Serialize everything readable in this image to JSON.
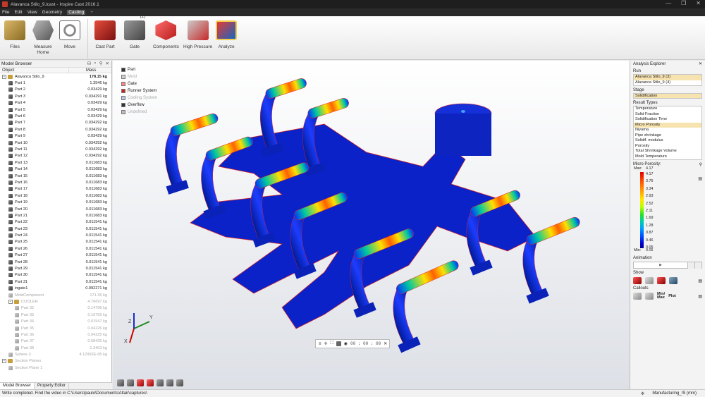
{
  "window": {
    "title": "Alavanca Stilo_9.icast - Inspire Cast 2016.1",
    "controls": [
      "—",
      "❐",
      "✕"
    ]
  },
  "menu": [
    {
      "label": "File",
      "active": false
    },
    {
      "label": "Edit",
      "active": false
    },
    {
      "label": "View",
      "active": false
    },
    {
      "label": "Geometry",
      "active": false
    },
    {
      "label": "Casting",
      "active": true
    }
  ],
  "ribbon": {
    "files": "Files",
    "measure": "Measure",
    "home": "Home",
    "move": "Move",
    "cast_part": "Cast Part",
    "gate": "Gate",
    "gate_badge": "(1)",
    "components": "Components",
    "high_pressure": "High Pressure",
    "analyze": "Analyze"
  },
  "model_browser": {
    "title": "Model Browser",
    "col_object": "Object",
    "col_mass": "Mass",
    "rows": [
      {
        "name": "Alavanca Stilo_9",
        "mass": "178.15 kg",
        "level": 0,
        "type": "asm",
        "expand": "−",
        "bold": true,
        "dim": false
      },
      {
        "name": "Part 1",
        "mass": "1.3546 kg",
        "level": 1,
        "type": "part",
        "dim": false
      },
      {
        "name": "Part 2",
        "mass": "0.03429 kg",
        "level": 1,
        "type": "part",
        "dim": false
      },
      {
        "name": "Part 3",
        "mass": "0.034291 kg",
        "level": 1,
        "type": "part",
        "dim": false
      },
      {
        "name": "Part 4",
        "mass": "0.03429 kg",
        "level": 1,
        "type": "part",
        "dim": false
      },
      {
        "name": "Part 5",
        "mass": "0.03429 kg",
        "level": 1,
        "type": "part",
        "dim": false
      },
      {
        "name": "Part 6",
        "mass": "0.03429 kg",
        "level": 1,
        "type": "part",
        "dim": false
      },
      {
        "name": "Part 7",
        "mass": "0.034292 kg",
        "level": 1,
        "type": "part",
        "dim": false
      },
      {
        "name": "Part 8",
        "mass": "0.034292 kg",
        "level": 1,
        "type": "part",
        "dim": false
      },
      {
        "name": "Part 9",
        "mass": "0.03429 kg",
        "level": 1,
        "type": "part",
        "dim": false
      },
      {
        "name": "Part 10",
        "mass": "0.034292 kg",
        "level": 1,
        "type": "part",
        "dim": false
      },
      {
        "name": "Part 11",
        "mass": "0.034292 kg",
        "level": 1,
        "type": "part",
        "dim": false
      },
      {
        "name": "Part 12",
        "mass": "0.034292 kg",
        "level": 1,
        "type": "part",
        "dim": false
      },
      {
        "name": "Part 13",
        "mass": "0.011683 kg",
        "level": 1,
        "type": "part",
        "dim": false
      },
      {
        "name": "Part 14",
        "mass": "0.011683 kg",
        "level": 1,
        "type": "part",
        "dim": false
      },
      {
        "name": "Part 15",
        "mass": "0.011683 kg",
        "level": 1,
        "type": "part",
        "dim": false
      },
      {
        "name": "Part 16",
        "mass": "0.011683 kg",
        "level": 1,
        "type": "part",
        "dim": false
      },
      {
        "name": "Part 17",
        "mass": "0.011683 kg",
        "level": 1,
        "type": "part",
        "dim": false
      },
      {
        "name": "Part 18",
        "mass": "0.011683 kg",
        "level": 1,
        "type": "part",
        "dim": false
      },
      {
        "name": "Part 19",
        "mass": "0.011683 kg",
        "level": 1,
        "type": "part",
        "dim": false
      },
      {
        "name": "Part 20",
        "mass": "0.011683 kg",
        "level": 1,
        "type": "part",
        "dim": false
      },
      {
        "name": "Part 21",
        "mass": "0.011683 kg",
        "level": 1,
        "type": "part",
        "dim": false
      },
      {
        "name": "Part 22",
        "mass": "0.011541 kg",
        "level": 1,
        "type": "part",
        "dim": false
      },
      {
        "name": "Part 23",
        "mass": "0.011541 kg",
        "level": 1,
        "type": "part",
        "dim": false
      },
      {
        "name": "Part 24",
        "mass": "0.011541 kg",
        "level": 1,
        "type": "part",
        "dim": false
      },
      {
        "name": "Part 25",
        "mass": "0.011541 kg",
        "level": 1,
        "type": "part",
        "dim": false
      },
      {
        "name": "Part 26",
        "mass": "0.011541 kg",
        "level": 1,
        "type": "part",
        "dim": false
      },
      {
        "name": "Part 27",
        "mass": "0.011541 kg",
        "level": 1,
        "type": "part",
        "dim": false
      },
      {
        "name": "Part 28",
        "mass": "0.011541 kg",
        "level": 1,
        "type": "part",
        "dim": false
      },
      {
        "name": "Part 29",
        "mass": "0.011541 kg",
        "level": 1,
        "type": "part",
        "dim": false
      },
      {
        "name": "Part 30",
        "mass": "0.011541 kg",
        "level": 1,
        "type": "part",
        "dim": false
      },
      {
        "name": "Part 31",
        "mass": "0.011541 kg",
        "level": 1,
        "type": "part",
        "dim": false
      },
      {
        "name": "ingate1",
        "mass": "0.092271 kg",
        "level": 1,
        "type": "part",
        "dim": false
      },
      {
        "name": "MoldComponent",
        "mass": "171.36 kg",
        "level": 1,
        "type": "partlight",
        "dim": true
      },
      {
        "name": "COOLER",
        "mass": "4.76697 kg",
        "level": 1,
        "type": "asm",
        "expand": "−",
        "dim": true
      },
      {
        "name": "Part 32",
        "mass": "0.14796 kg",
        "level": 2,
        "type": "partlight",
        "dim": true
      },
      {
        "name": "Part 33",
        "mass": "0.19792 kg",
        "level": 2,
        "type": "partlight",
        "dim": true
      },
      {
        "name": "Part 34",
        "mass": "0.01547 kg",
        "level": 2,
        "type": "partlight",
        "dim": true
      },
      {
        "name": "Part 35",
        "mass": "0.04226 kg",
        "level": 2,
        "type": "partlight",
        "dim": true
      },
      {
        "name": "Part 36",
        "mass": "0.04225 kg",
        "level": 2,
        "type": "partlight",
        "dim": true
      },
      {
        "name": "Part 37",
        "mass": "0.58425 kg",
        "level": 2,
        "type": "partlight",
        "dim": true
      },
      {
        "name": "Part 38",
        "mass": "1.3403 kg",
        "level": 2,
        "type": "partlight",
        "dim": true
      },
      {
        "name": "Sphere 3",
        "mass": "4.12992E-05 kg",
        "level": 1,
        "type": "partlight",
        "dim": true
      },
      {
        "name": "Section Planes",
        "mass": "",
        "level": 0,
        "type": "asm",
        "expand": "−",
        "dim": true
      },
      {
        "name": "Section Plane 1",
        "mass": "",
        "level": 1,
        "type": "partlight",
        "dim": true
      }
    ],
    "tabs": [
      "Model Browser",
      "Property Editor"
    ]
  },
  "viewport": {
    "legend": [
      {
        "label": "Part",
        "color": "#333333",
        "dim": false
      },
      {
        "label": "Mold",
        "color": "#cfcfcf",
        "dim": true
      },
      {
        "label": "Gate",
        "color": "#ff8080",
        "dim": false
      },
      {
        "label": "Runner System",
        "color": "#cc2222",
        "dim": false
      },
      {
        "label": "Cooling System",
        "color": "#b7c7e8",
        "dim": true
      },
      {
        "label": "Overflow",
        "color": "#333333",
        "dim": false
      },
      {
        "label": "Undefined",
        "color": "#bdbdbd",
        "dim": true
      }
    ],
    "playback_time": "00 : 00 : 00",
    "axis": {
      "x": "X",
      "y": "Y",
      "z": "Z"
    }
  },
  "analysis_explorer": {
    "title": "Analysis Explorer",
    "run_label": "Run",
    "runs": [
      "Alavanca Stilo_9 (3)",
      "Alavanca Stilo_9 (4)"
    ],
    "stage_label": "Stage",
    "stage_value": "Solidification",
    "result_types_label": "Result Types",
    "result_types": [
      "Temperature",
      "Solid Fraction",
      "Solidification Time",
      "Micro Porosity",
      "Niyama",
      "Pipe shrinkage",
      "Solidif. modulus",
      "Porosity",
      "Total Shrinkage Volume",
      "Mold Temperature"
    ],
    "selected_result": "Micro Porosity",
    "legend_title": "Micro Porosity:",
    "max_label": "Max:",
    "min_label": "Min:",
    "max_value": "4.17",
    "min_value": "0.05",
    "scale_values": [
      "4.17",
      "3.76",
      "3.34",
      "2.93",
      "2.52",
      "2.11",
      "1.69",
      "1.28",
      "0.87",
      "0.46",
      "0.05"
    ],
    "animation_label": "Animation",
    "show_label": "Show",
    "callouts_label": "Callouts",
    "minmax_label": "Min/\nMax",
    "plot_label": "Plot"
  },
  "status": {
    "message": "Write completed. Find the video in C:\\Users\\paulo\\Documents\\Altair\\captures\\",
    "units": "Manufacturing_IS (mm)"
  }
}
